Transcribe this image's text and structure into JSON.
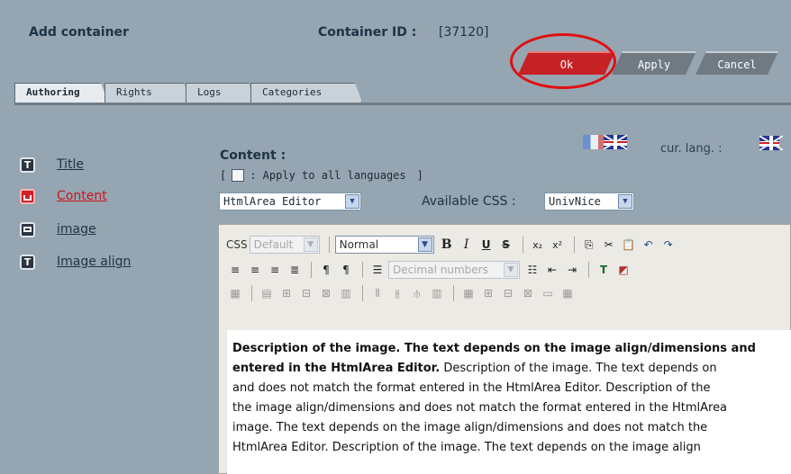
{
  "header": {
    "title": "Add container",
    "container_id_label": "Container ID :",
    "container_id_value": "[37120]"
  },
  "actions": {
    "ok": "Ok",
    "apply": "Apply",
    "cancel": "Cancel"
  },
  "tabs": [
    {
      "label": "Authoring",
      "active": true
    },
    {
      "label": "Rights",
      "active": false
    },
    {
      "label": "Logs",
      "active": false
    },
    {
      "label": "Categories",
      "active": false
    }
  ],
  "languages": {
    "current_label": "cur. lang. :",
    "flags": [
      "flag-fr-icon",
      "flag-uk-icon"
    ]
  },
  "sidebar": {
    "items": [
      {
        "label": "Title",
        "icon": "T",
        "active": false
      },
      {
        "label": "Content",
        "icon": "",
        "active": true
      },
      {
        "label": "image",
        "icon": "",
        "active": false
      },
      {
        "label": "Image align",
        "icon": "T",
        "active": false
      }
    ]
  },
  "content": {
    "label": "Content :",
    "apply_all": ": Apply to all languages",
    "bracket_open": "[",
    "bracket_close": "]",
    "editor_select": "HtmlArea Editor",
    "available_css_label": "Available CSS :",
    "css_select": "UnivNice"
  },
  "toolbar": {
    "css_label": "CSS",
    "css_select": "Default",
    "format_select": "Normal",
    "list_select": "Decimal numbers"
  },
  "editor": {
    "lines": [
      {
        "bold": "Description of the image. The text depends on the image align/dimensions and",
        "rest": ""
      },
      {
        "bold": "entered in the HtmlArea Editor.",
        "rest": " Description of the image. The text depends on"
      },
      {
        "bold": "",
        "rest": "and does not match the format entered in the HtmlArea Editor. Description of the"
      },
      {
        "bold": "",
        "rest": "the image align/dimensions and does not match the format entered in the HtmlArea"
      },
      {
        "bold": "",
        "rest": "image. The text depends on the image align/dimensions and does not match the"
      },
      {
        "bold": "",
        "rest": "HtmlArea Editor. Description of the image. The text depends on the image align"
      }
    ]
  },
  "colors": {
    "background": "#95a5b1",
    "ok_button": "#c62125",
    "annotation_ring": "#e10e12",
    "active_link": "#c8161c"
  }
}
